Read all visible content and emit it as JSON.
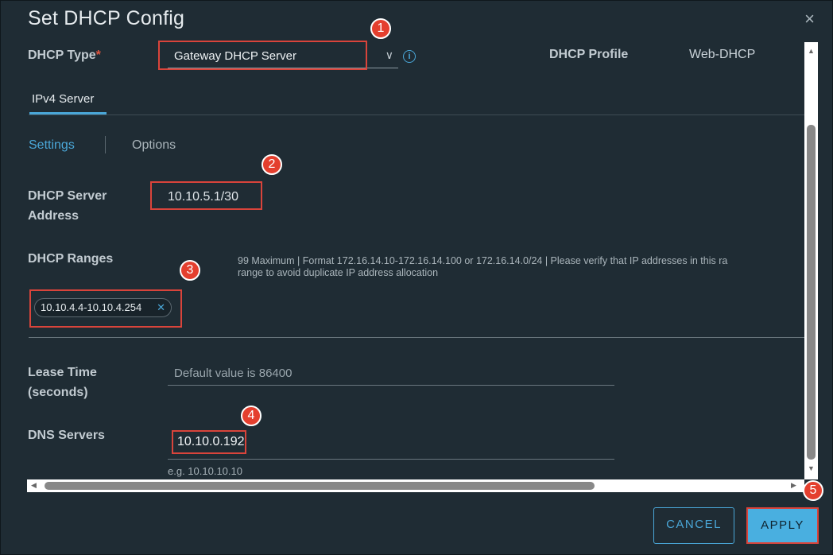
{
  "dialog": {
    "title": "Set DHCP Config",
    "close_icon": "×"
  },
  "dhcp_type": {
    "label": "DHCP Type",
    "required_mark": "*",
    "selected": "Gateway DHCP Server",
    "chevron": "∨",
    "info_icon": "i"
  },
  "header_links": {
    "profile": "DHCP Profile",
    "profile_value": "Web-DHCP"
  },
  "tabs": {
    "ipv4": "IPv4 Server"
  },
  "subtabs": {
    "settings": "Settings",
    "options": "Options"
  },
  "server_address": {
    "label_line1": "DHCP Server",
    "label_line2": "Address",
    "value": "10.10.5.1/30"
  },
  "ranges": {
    "label": "DHCP Ranges",
    "hint_line1": "99 Maximum | Format 172.16.14.10-172.16.14.100 or 172.16.14.0/24 | Please verify that IP addresses in this ra",
    "hint_line2": "range to avoid duplicate IP address allocation",
    "chip": "10.10.4.4-10.10.4.254",
    "chip_remove": "✕"
  },
  "lease": {
    "label_line1": "Lease Time",
    "label_line2": "(seconds)",
    "placeholder": "Default value is 86400"
  },
  "dns": {
    "label": "DNS Servers",
    "value": "10.10.0.192",
    "example": "e.g. 10.10.10.10"
  },
  "buttons": {
    "cancel": "CANCEL",
    "apply": "APPLY"
  },
  "badges": [
    "1",
    "2",
    "3",
    "4",
    "5"
  ],
  "scroll_arrows": {
    "up": "▲",
    "down": "▼",
    "left": "◀",
    "right": "▶"
  },
  "colors": {
    "accent": "#4aa7d8",
    "highlight_red": "#d9443b",
    "background": "#1f2c34"
  }
}
